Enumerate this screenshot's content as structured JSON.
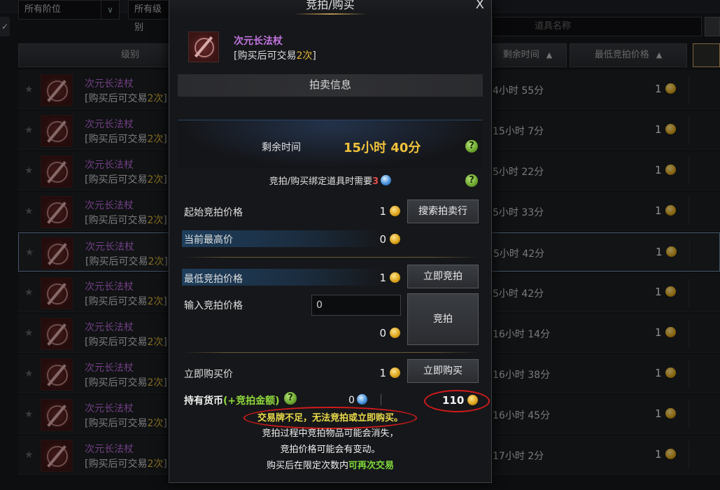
{
  "background": {
    "filters": {
      "tier_dropdown": "所有阶位",
      "level_dropdown": "所有级别",
      "search_placeholder": "道具名称"
    },
    "headers": {
      "level": "级别",
      "remaining_time": "剩余时间",
      "min_bid_price": "最低竞拍价格",
      "sort_arrow": "▲"
    },
    "rows": [
      {
        "name": "次元长法杖",
        "trade_prefix": "[购买后可交易",
        "trade_count": "2次",
        "trade_suffix": "]",
        "remaining": "4小时 55分",
        "price": "1"
      },
      {
        "name": "次元长法杖",
        "trade_prefix": "[购买后可交易",
        "trade_count": "2次",
        "trade_suffix": "]",
        "remaining": "15小时 7分",
        "price": "1"
      },
      {
        "name": "次元长法杖",
        "trade_prefix": "[购买后可交易",
        "trade_count": "2次",
        "trade_suffix": "]",
        "remaining": "5小时 22分",
        "price": "1"
      },
      {
        "name": "次元长法杖",
        "trade_prefix": "[购买后可交易",
        "trade_count": "2次",
        "trade_suffix": "]",
        "remaining": "5小时 33分",
        "price": "1"
      },
      {
        "name": "次元长法杖",
        "trade_prefix": "[购买后可交易",
        "trade_count": "2次",
        "trade_suffix": "]",
        "remaining": "5小时 42分",
        "price": "1"
      },
      {
        "name": "次元长法杖",
        "trade_prefix": "[购买后可交易",
        "trade_count": "2次",
        "trade_suffix": "]",
        "remaining": "5小时 42分",
        "price": "1"
      },
      {
        "name": "次元长法杖",
        "trade_prefix": "[购买后可交易",
        "trade_count": "2次",
        "trade_suffix": "]",
        "remaining": "16小时 14分",
        "price": "1"
      },
      {
        "name": "次元长法杖",
        "trade_prefix": "[购买后可交易",
        "trade_count": "2次",
        "trade_suffix": "]",
        "remaining": "16小时 38分",
        "price": "1"
      },
      {
        "name": "次元长法杖",
        "trade_prefix": "[购买后可交易",
        "trade_count": "2次",
        "trade_suffix": "]",
        "remaining": "16小时 45分",
        "price": "1"
      },
      {
        "name": "次元长法杖",
        "trade_prefix": "[购买后可交易",
        "trade_count": "2次",
        "trade_suffix": "]",
        "remaining": "17小时 2分",
        "price": "1"
      }
    ],
    "selected_row_index": 4
  },
  "modal": {
    "title": "竞拍/购买",
    "close": "X",
    "item": {
      "name": "次元长法杖",
      "trade_prefix": "[购买后可交易",
      "trade_count": "2次",
      "trade_suffix": "]"
    },
    "section_title": "拍卖信息",
    "remaining_label": "剩余时间",
    "remaining_value": "15小时 40分",
    "help_glyph": "?",
    "bind_text": "竞拍/购买绑定道具时需要",
    "bind_count": "3",
    "start_price_label": "起始竞拍价格",
    "start_price_value": "1",
    "search_auction_button": "搜索拍卖行",
    "current_high_label": "当前最高价",
    "current_high_value": "0",
    "min_bid_label": "最低竞拍价格",
    "min_bid_value": "1",
    "instant_bid_button": "立即竞拍",
    "input_bid_label": "输入竞拍价格",
    "input_bid_value": "0",
    "bid_total_value": "0",
    "bid_button": "竞拍",
    "buy_now_label": "立即购买价",
    "buy_now_value": "1",
    "buy_now_button": "立即购买",
    "currency_label": "持有货币",
    "currency_bonus": "(+竞拍金额)",
    "token_value": "0",
    "gold_value": "110",
    "warning": "交易牌不足，无法竞拍或立即购买。",
    "notes": [
      "竞拍过程中竞拍物品可能会消失，",
      "竞拍价格可能会有变动。"
    ],
    "note_last_prefix": "购买后在限定次数内",
    "note_last_green": "可再次交易"
  },
  "colors": {
    "item_name": "#c274e0",
    "trade_count": "#e0b43a",
    "time_value": "#f0c23a",
    "warning": "#eadb4a",
    "highlight_ellipse": "#d11b1b"
  },
  "icons": {
    "coin": "gold-coin-icon",
    "token": "blue-token-icon",
    "help": "help-icon",
    "star": "favorite-star-icon"
  }
}
